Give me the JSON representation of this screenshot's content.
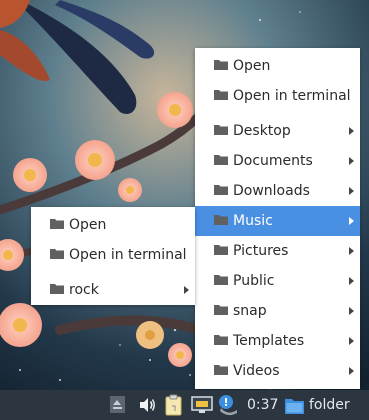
{
  "colors": {
    "menu_bg": "#ffffff",
    "highlight": "#4a90e2",
    "folder_icon": "#606060",
    "taskbar_bg": "#2c3640"
  },
  "icons": {
    "menu_item": "folder-icon",
    "submenu": "arrow-right-icon",
    "tray": [
      "show-desktop-icon",
      "volume-icon",
      "clipboard-icon",
      "network-icon",
      "notification-icon",
      "folder-icon"
    ]
  },
  "main_menu": {
    "items": [
      {
        "label": "Open",
        "submenu": false
      },
      {
        "label": "Open in terminal",
        "submenu": false
      },
      {
        "label": "Desktop",
        "submenu": true
      },
      {
        "label": "Documents",
        "submenu": true
      },
      {
        "label": "Downloads",
        "submenu": true
      },
      {
        "label": "Music",
        "submenu": true,
        "selected": true
      },
      {
        "label": "Pictures",
        "submenu": true
      },
      {
        "label": "Public",
        "submenu": true
      },
      {
        "label": "snap",
        "submenu": true
      },
      {
        "label": "Templates",
        "submenu": true
      },
      {
        "label": "Videos",
        "submenu": true
      }
    ]
  },
  "sub_menu": {
    "items": [
      {
        "label": "Open",
        "submenu": false
      },
      {
        "label": "Open in terminal",
        "submenu": false
      },
      {
        "label": "rock",
        "submenu": true
      }
    ]
  },
  "taskbar": {
    "clock": "0:37",
    "task_label": "folder"
  }
}
